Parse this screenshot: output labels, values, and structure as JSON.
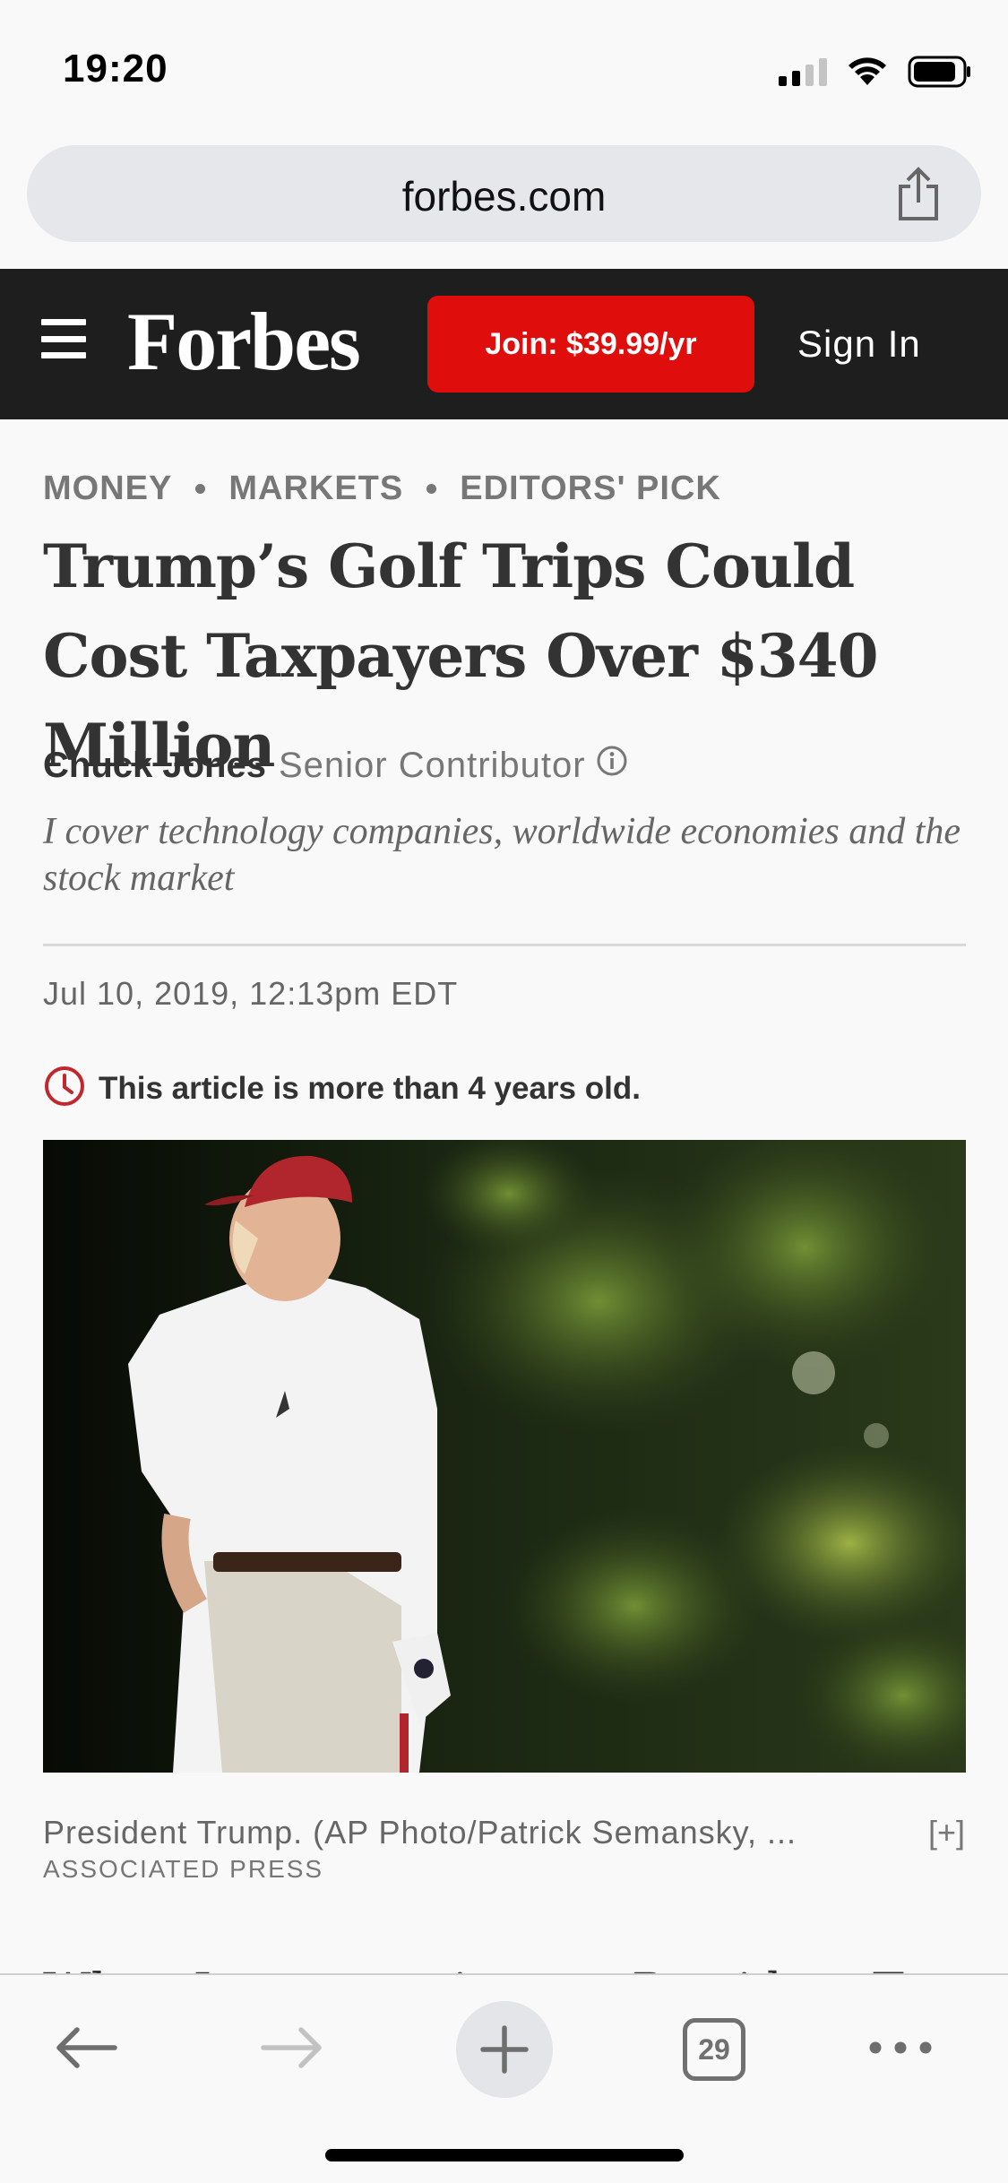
{
  "status_bar": {
    "time": "19:20"
  },
  "browser": {
    "url": "forbes.com",
    "tab_count": "29"
  },
  "header": {
    "logo": "Forbes",
    "join_label": "Join: $39.99/yr",
    "signin_label": "Sign In"
  },
  "article": {
    "breadcrumbs": [
      "MONEY",
      "MARKETS",
      "EDITORS' PICK"
    ],
    "headline": "Trump’s Golf Trips Could Cost Taxpayers Over $340 Million",
    "author": "Chuck Jones",
    "role": "Senior Contributor",
    "bio": "I cover technology companies, worldwide economies and the stock market",
    "date": "Jul 10, 2019,  12:13pm EDT",
    "age_notice": "This article is more than 4 years old.",
    "caption": "President Trump. (AP Photo/Patrick Semansky, ...",
    "credit": "ASSOCIATED PRESS",
    "expand_label": "[+]",
    "next_paragraph_fragment": "When I was growing up, President Tr"
  },
  "colors": {
    "brand_red": "#e00d0d",
    "header_bg": "#1e1e1e",
    "clock_icon": "#c0282d"
  },
  "icons": [
    "share-icon",
    "hamburger-icon",
    "info-icon",
    "clock-icon",
    "back-arrow-icon",
    "forward-arrow-icon",
    "plus-icon",
    "tabs-icon",
    "more-icon"
  ]
}
